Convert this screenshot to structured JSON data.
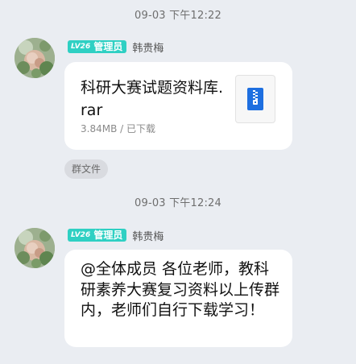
{
  "messages": [
    {
      "timestamp": "09-03 下午12:22",
      "badge_level": "LV26",
      "badge_role": "管理员",
      "sender": "韩贵梅",
      "file_name": "科研大赛试题资料库.rar",
      "file_meta": "3.84MB / 已下载",
      "file_icon": "zip-archive-icon",
      "tag": "群文件"
    },
    {
      "timestamp": "09-03 下午12:24",
      "badge_level": "LV26",
      "badge_role": "管理员",
      "sender": "韩贵梅",
      "text": "@全体成员 各位老师，教科研素养大赛复习资料以上传群内，老师们自行下载学习！"
    }
  ],
  "colors": {
    "background": "#eaedf2",
    "badge": "#2fd0c3",
    "bubble": "#ffffff",
    "zip_icon": "#1e6fe0"
  }
}
